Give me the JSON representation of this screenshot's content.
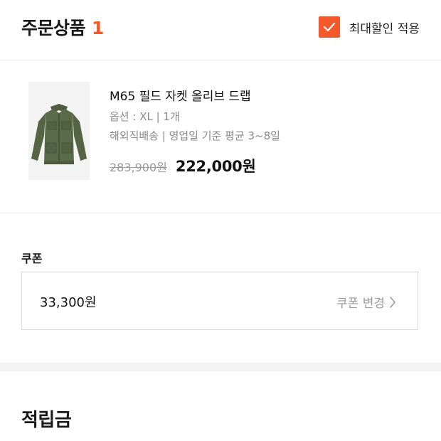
{
  "order_section": {
    "title": "주문상품",
    "count": "1",
    "max_discount_label": "최대할인 적용",
    "max_discount_checked": true,
    "accent_color": "#f5582a"
  },
  "product": {
    "image_icon": "olive-field-jacket-image",
    "name": "M65 필드 자켓 올리브 드랩",
    "option": "옵션 : XL | 1개",
    "shipping": "해외직배송 | 영업일 기준 평균 3~8일",
    "original_price": "283,900원",
    "sale_price": "222,000원"
  },
  "coupon": {
    "label": "쿠폰",
    "amount": "33,300원",
    "change_label": "쿠폰 변경",
    "change_icon": "chevron-right-icon"
  },
  "points": {
    "title": "적립금"
  }
}
